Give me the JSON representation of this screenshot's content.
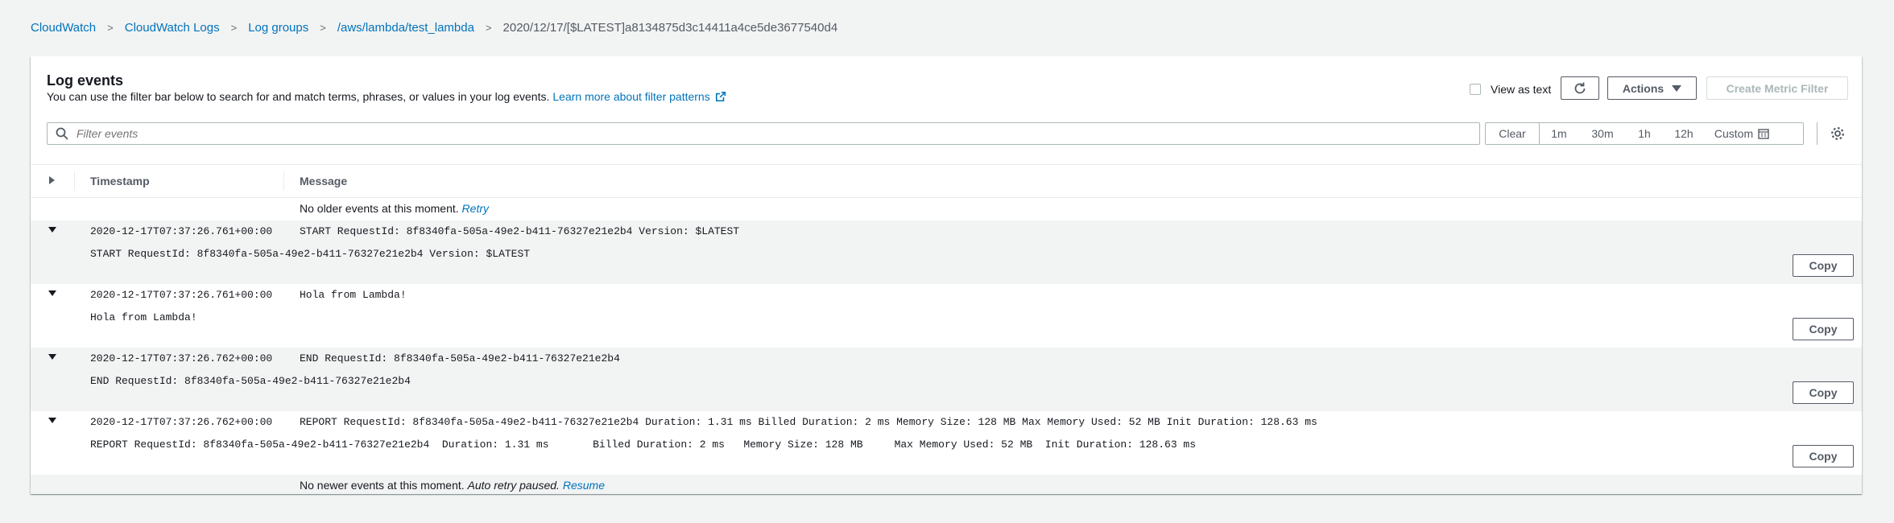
{
  "breadcrumb": [
    "CloudWatch",
    "CloudWatch Logs",
    "Log groups",
    "/aws/lambda/test_lambda"
  ],
  "breadcrumb_current": "2020/12/17/[$LATEST]a8134875d3c14411a4ce5de3677540d4",
  "panel": {
    "title": "Log events",
    "description": "You can use the filter bar below to search for and match terms, phrases, or values in your log events.",
    "learn_more": "Learn more about filter patterns"
  },
  "toolbar": {
    "view_as_text": "View as text",
    "actions": "Actions",
    "create_metric_filter": "Create Metric Filter"
  },
  "filter": {
    "placeholder": "Filter events"
  },
  "time_range": {
    "clear": "Clear",
    "options": [
      "1m",
      "30m",
      "1h",
      "12h"
    ],
    "custom": "Custom"
  },
  "table": {
    "col_timestamp": "Timestamp",
    "col_message": "Message"
  },
  "notices": {
    "older": "No older events at this moment.",
    "retry": "Retry",
    "newer": "No newer events at this moment.",
    "auto_retry": "Auto retry paused.",
    "resume": "Resume"
  },
  "copy_label": "Copy",
  "events": [
    {
      "timestamp": "2020-12-17T07:37:26.761+00:00",
      "message": "START RequestId: 8f8340fa-505a-49e2-b411-76327e21e2b4 Version: $LATEST",
      "detail": "START RequestId: 8f8340fa-505a-49e2-b411-76327e21e2b4 Version: $LATEST"
    },
    {
      "timestamp": "2020-12-17T07:37:26.761+00:00",
      "message": "Hola from Lambda!",
      "detail": "Hola from Lambda!"
    },
    {
      "timestamp": "2020-12-17T07:37:26.762+00:00",
      "message": "END RequestId: 8f8340fa-505a-49e2-b411-76327e21e2b4",
      "detail": "END RequestId: 8f8340fa-505a-49e2-b411-76327e21e2b4"
    },
    {
      "timestamp": "2020-12-17T07:37:26.762+00:00",
      "message": "REPORT RequestId: 8f8340fa-505a-49e2-b411-76327e21e2b4 Duration: 1.31 ms Billed Duration: 2 ms Memory Size: 128 MB Max Memory Used: 52 MB Init Duration: 128.63 ms",
      "detail": "REPORT RequestId: 8f8340fa-505a-49e2-b411-76327e21e2b4  Duration: 1.31 ms       Billed Duration: 2 ms   Memory Size: 128 MB     Max Memory Used: 52 MB  Init Duration: 128.63 ms"
    }
  ]
}
